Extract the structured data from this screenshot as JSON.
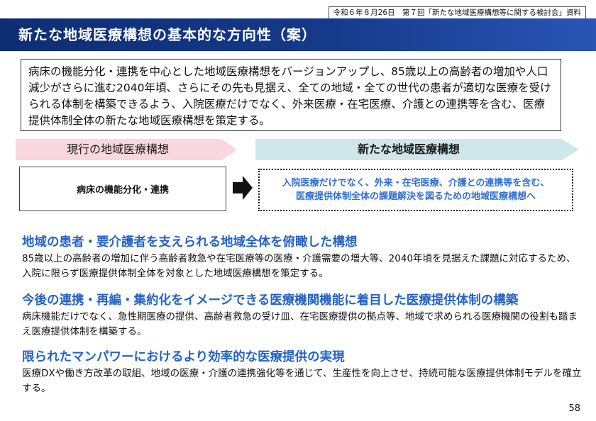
{
  "source": "令和６年８月26日　第７回「新たな地域医療構想等に関する検討会」資料",
  "title": "新たな地域医療構想の基本的な方向性（案）",
  "intro": "病床の機能分化・連携を中心とした地域医療構想をバージョンアップし、85歳以上の高齢者の増加や人口減少がさらに進む2040年頃、さらにその先も見据え、全ての地域・全ての世代の患者が適切な医療を受けられる体制を構築できるよう、入院医療だけでなく、外来医療・在宅医療、介護との連携等を含む、医療提供体制全体の新たな地域医療構想を策定する。",
  "current": {
    "label": "現行の地域医療構想",
    "box": "病床の機能分化・連携",
    "color": "#f9d7dc"
  },
  "new": {
    "label": "新たな地域医療構想",
    "box_line1": "入院医療だけでなく、外来・在宅医療、介護との連携等を含む、",
    "box_line2": "医療提供体制全体の課題解決を図るための地域医療構想へ",
    "color": "#cfe7ea"
  },
  "sections": [
    {
      "heading": "地域の患者・要介護者を支えられる地域全体を俯瞰した構想",
      "body": "85歳以上の高齢者の増加に伴う高齢者救急や在宅医療等の医療・介護需要の増大等、2040年頃を見据えた課題に対応するため、入院に限らず医療提供体制全体を対象とした地域医療構想を策定する。"
    },
    {
      "heading": "今後の連携・再編・集約化をイメージできる医療機関機能に着目した医療提供体制の構築",
      "body": "病床機能だけでなく、急性期医療の提供、高齢者救急の受け皿、在宅医療提供の拠点等、地域で求められる医療機関の役割も踏まえ医療提供体制を構築する。"
    },
    {
      "heading": "限られたマンパワーにおけるより効率的な医療提供の実現",
      "body": "医療DXや働き方改革の取組、地域の医療・介護の連携強化等を通じて、生産性を向上させ、持続可能な医療提供体制モデルを確立する。"
    }
  ],
  "page_number": "58",
  "colors": {
    "header": "#153a8a",
    "accent": "#2563c4"
  }
}
